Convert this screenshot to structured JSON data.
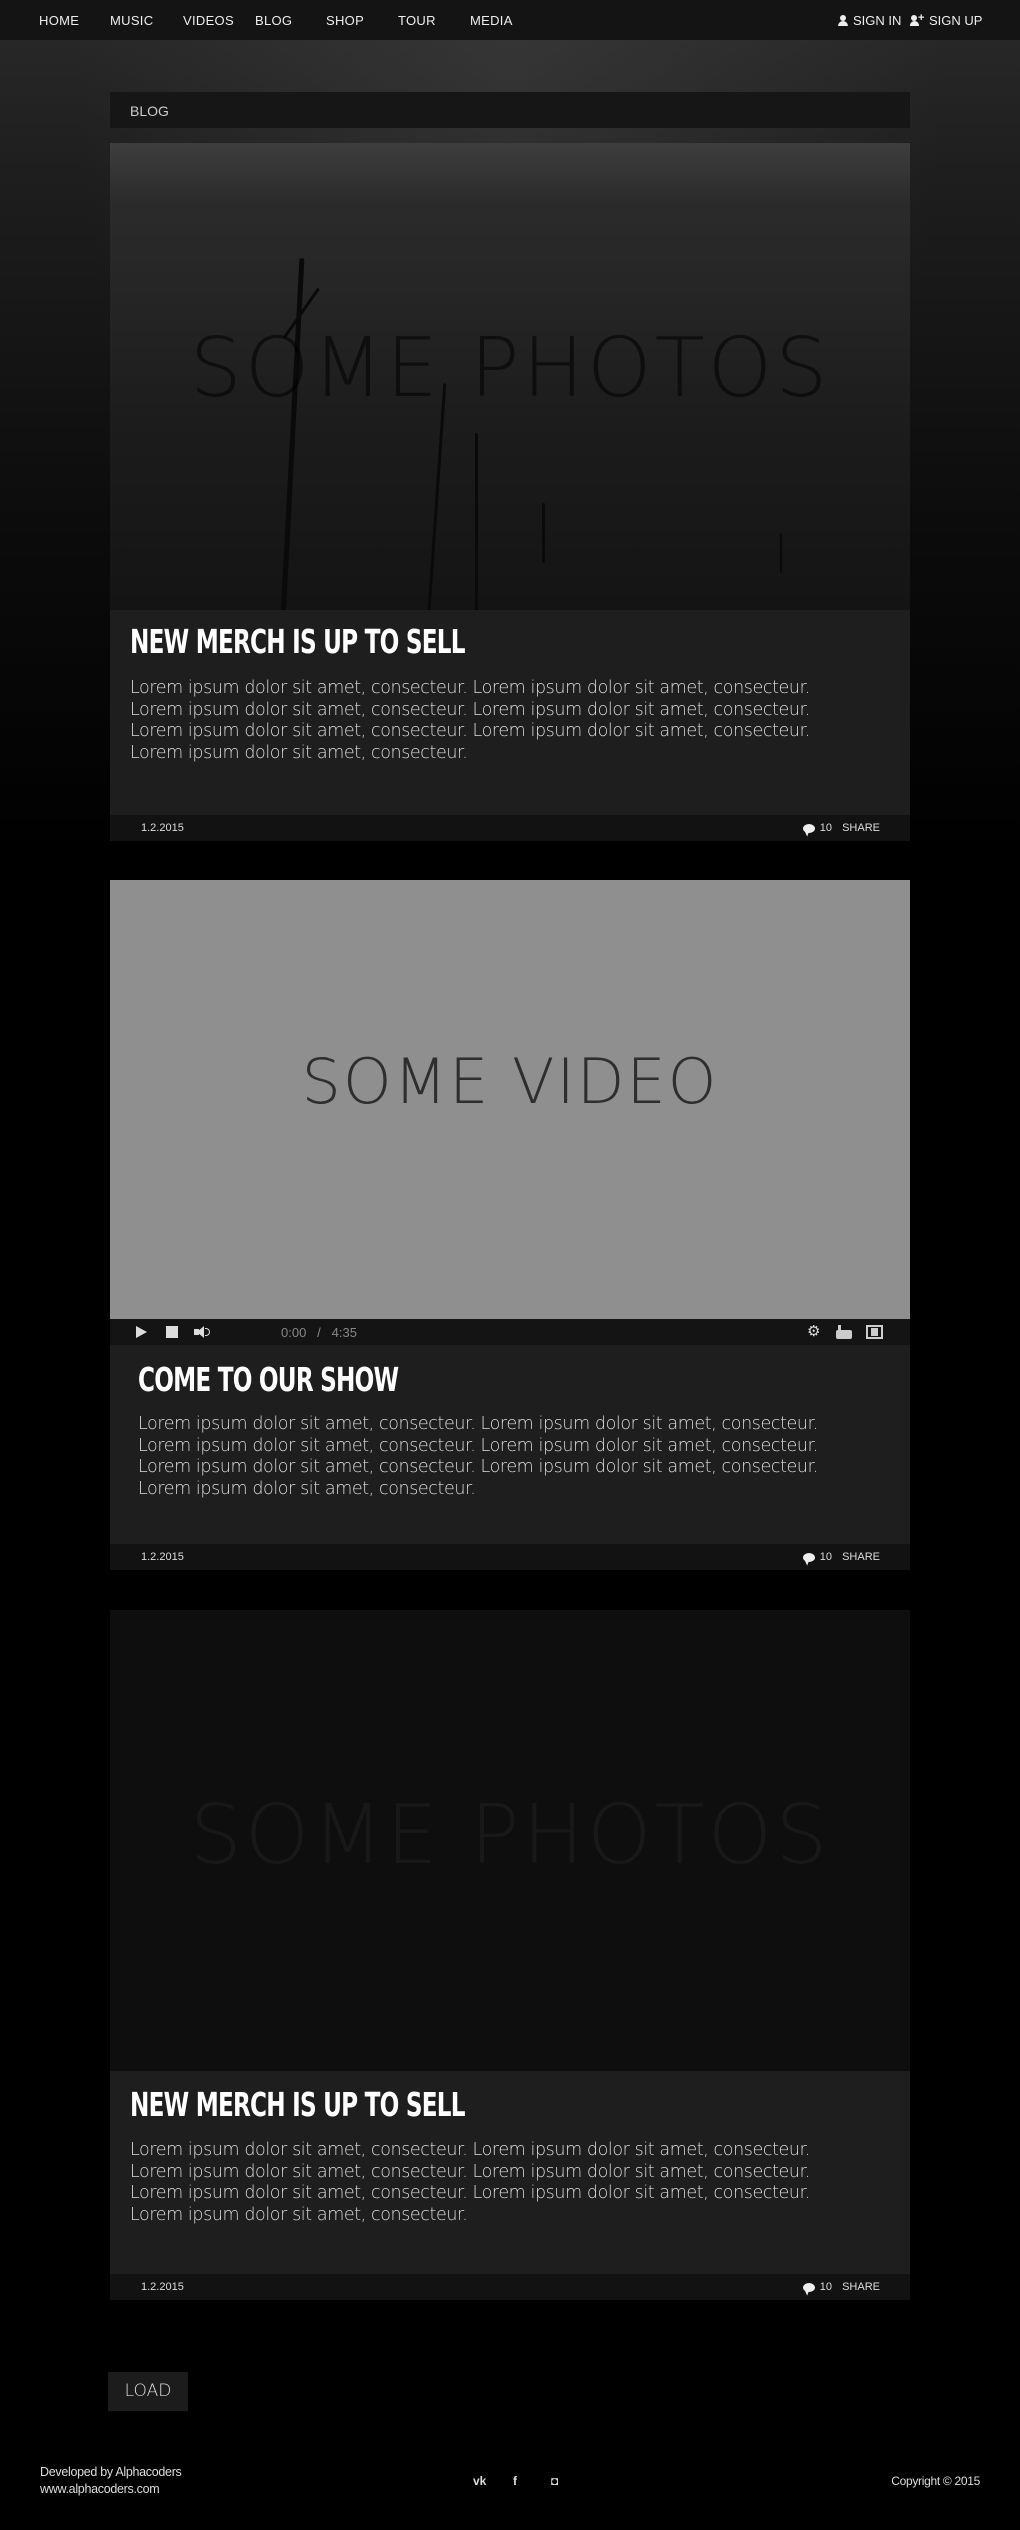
{
  "nav": {
    "items": [
      "HOME",
      "MUSIC",
      "VIDEOS",
      "BLOG",
      "SHOP",
      "TOUR",
      "MEDIA"
    ],
    "sign_in": "SIGN IN",
    "sign_up": "SIGN UP"
  },
  "blog": {
    "header": "BLOG"
  },
  "posts": [
    {
      "media_type": "photo",
      "media_text": "SOME PHOTOS",
      "title": "NEW MERCH IS UP TO SELL",
      "text": "Lorem ipsum dolor sit amet, consecteur. Lorem ipsum dolor sit amet, consecteur. Lorem ipsum dolor sit amet, consecteur. Lorem ipsum dolor sit amet, consecteur. Lorem ipsum dolor sit amet, consecteur. Lorem ipsum dolor sit amet, consecteur. Lorem ipsum dolor sit amet, consecteur.",
      "date": "1.2.2015",
      "comments": "10",
      "share": "SHARE"
    },
    {
      "media_type": "video",
      "media_text": "SOME VIDEO",
      "video_time": "0:00",
      "video_sep": "/",
      "video_duration": "4:35",
      "title": "COME TO OUR SHOW",
      "text": "Lorem ipsum dolor sit amet, consecteur. Lorem ipsum dolor sit amet, consecteur. Lorem ipsum dolor sit amet, consecteur. Lorem ipsum dolor sit amet, consecteur. Lorem ipsum dolor sit amet, consecteur. Lorem ipsum dolor sit amet, consecteur. Lorem ipsum dolor sit amet, consecteur.",
      "date": "1.2.2015",
      "comments": "10",
      "share": "SHARE"
    },
    {
      "media_type": "photo",
      "media_text": "SOME PHOTOS",
      "title": "NEW MERCH IS UP TO SELL",
      "text": "Lorem ipsum dolor sit amet, consecteur. Lorem ipsum dolor sit amet, consecteur. Lorem ipsum dolor sit amet, consecteur. Lorem ipsum dolor sit amet, consecteur. Lorem ipsum dolor sit amet, consecteur. Lorem ipsum dolor sit amet, consecteur. Lorem ipsum dolor sit amet, consecteur.",
      "date": "1.2.2015",
      "comments": "10",
      "share": "SHARE"
    }
  ],
  "load_label": "LOAD",
  "footer": {
    "developed_by": "Developed by Alphacoders",
    "site": "www.alphacoders.com",
    "social_icons": [
      "vk-icon",
      "facebook-icon",
      "instagram-icon"
    ],
    "vk_glyph": "vk",
    "facebook_glyph": "f",
    "instagram_glyph": "◘",
    "copyright": "Copyright © 2015"
  },
  "colors": {
    "background": "#000000",
    "panel": "#1e1e1e",
    "video_placeholder": "#8f8f8f"
  }
}
